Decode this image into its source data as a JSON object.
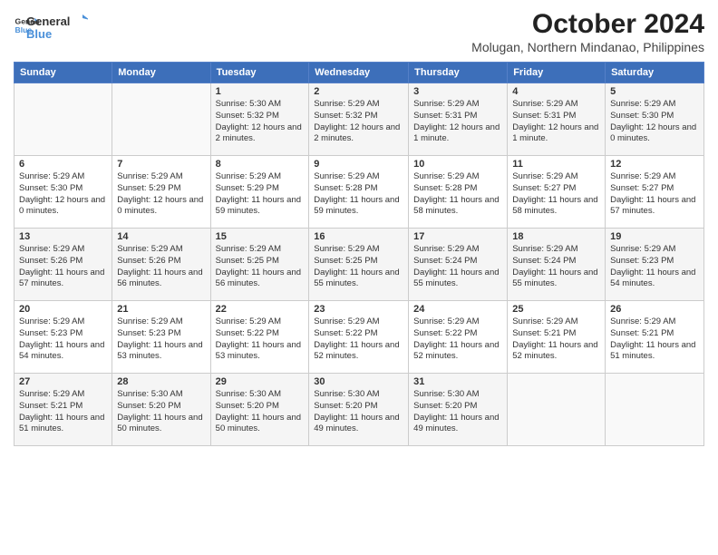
{
  "header": {
    "logo_line1": "General",
    "logo_line2": "Blue",
    "title": "October 2024",
    "subtitle": "Molugan, Northern Mindanao, Philippines"
  },
  "days_of_week": [
    "Sunday",
    "Monday",
    "Tuesday",
    "Wednesday",
    "Thursday",
    "Friday",
    "Saturday"
  ],
  "weeks": [
    [
      {
        "day": "",
        "content": ""
      },
      {
        "day": "",
        "content": ""
      },
      {
        "day": "1",
        "content": "Sunrise: 5:30 AM\nSunset: 5:32 PM\nDaylight: 12 hours and 2 minutes."
      },
      {
        "day": "2",
        "content": "Sunrise: 5:29 AM\nSunset: 5:32 PM\nDaylight: 12 hours and 2 minutes."
      },
      {
        "day": "3",
        "content": "Sunrise: 5:29 AM\nSunset: 5:31 PM\nDaylight: 12 hours and 1 minute."
      },
      {
        "day": "4",
        "content": "Sunrise: 5:29 AM\nSunset: 5:31 PM\nDaylight: 12 hours and 1 minute."
      },
      {
        "day": "5",
        "content": "Sunrise: 5:29 AM\nSunset: 5:30 PM\nDaylight: 12 hours and 0 minutes."
      }
    ],
    [
      {
        "day": "6",
        "content": "Sunrise: 5:29 AM\nSunset: 5:30 PM\nDaylight: 12 hours and 0 minutes."
      },
      {
        "day": "7",
        "content": "Sunrise: 5:29 AM\nSunset: 5:29 PM\nDaylight: 12 hours and 0 minutes."
      },
      {
        "day": "8",
        "content": "Sunrise: 5:29 AM\nSunset: 5:29 PM\nDaylight: 11 hours and 59 minutes."
      },
      {
        "day": "9",
        "content": "Sunrise: 5:29 AM\nSunset: 5:28 PM\nDaylight: 11 hours and 59 minutes."
      },
      {
        "day": "10",
        "content": "Sunrise: 5:29 AM\nSunset: 5:28 PM\nDaylight: 11 hours and 58 minutes."
      },
      {
        "day": "11",
        "content": "Sunrise: 5:29 AM\nSunset: 5:27 PM\nDaylight: 11 hours and 58 minutes."
      },
      {
        "day": "12",
        "content": "Sunrise: 5:29 AM\nSunset: 5:27 PM\nDaylight: 11 hours and 57 minutes."
      }
    ],
    [
      {
        "day": "13",
        "content": "Sunrise: 5:29 AM\nSunset: 5:26 PM\nDaylight: 11 hours and 57 minutes."
      },
      {
        "day": "14",
        "content": "Sunrise: 5:29 AM\nSunset: 5:26 PM\nDaylight: 11 hours and 56 minutes."
      },
      {
        "day": "15",
        "content": "Sunrise: 5:29 AM\nSunset: 5:25 PM\nDaylight: 11 hours and 56 minutes."
      },
      {
        "day": "16",
        "content": "Sunrise: 5:29 AM\nSunset: 5:25 PM\nDaylight: 11 hours and 55 minutes."
      },
      {
        "day": "17",
        "content": "Sunrise: 5:29 AM\nSunset: 5:24 PM\nDaylight: 11 hours and 55 minutes."
      },
      {
        "day": "18",
        "content": "Sunrise: 5:29 AM\nSunset: 5:24 PM\nDaylight: 11 hours and 55 minutes."
      },
      {
        "day": "19",
        "content": "Sunrise: 5:29 AM\nSunset: 5:23 PM\nDaylight: 11 hours and 54 minutes."
      }
    ],
    [
      {
        "day": "20",
        "content": "Sunrise: 5:29 AM\nSunset: 5:23 PM\nDaylight: 11 hours and 54 minutes."
      },
      {
        "day": "21",
        "content": "Sunrise: 5:29 AM\nSunset: 5:23 PM\nDaylight: 11 hours and 53 minutes."
      },
      {
        "day": "22",
        "content": "Sunrise: 5:29 AM\nSunset: 5:22 PM\nDaylight: 11 hours and 53 minutes."
      },
      {
        "day": "23",
        "content": "Sunrise: 5:29 AM\nSunset: 5:22 PM\nDaylight: 11 hours and 52 minutes."
      },
      {
        "day": "24",
        "content": "Sunrise: 5:29 AM\nSunset: 5:22 PM\nDaylight: 11 hours and 52 minutes."
      },
      {
        "day": "25",
        "content": "Sunrise: 5:29 AM\nSunset: 5:21 PM\nDaylight: 11 hours and 52 minutes."
      },
      {
        "day": "26",
        "content": "Sunrise: 5:29 AM\nSunset: 5:21 PM\nDaylight: 11 hours and 51 minutes."
      }
    ],
    [
      {
        "day": "27",
        "content": "Sunrise: 5:29 AM\nSunset: 5:21 PM\nDaylight: 11 hours and 51 minutes."
      },
      {
        "day": "28",
        "content": "Sunrise: 5:30 AM\nSunset: 5:20 PM\nDaylight: 11 hours and 50 minutes."
      },
      {
        "day": "29",
        "content": "Sunrise: 5:30 AM\nSunset: 5:20 PM\nDaylight: 11 hours and 50 minutes."
      },
      {
        "day": "30",
        "content": "Sunrise: 5:30 AM\nSunset: 5:20 PM\nDaylight: 11 hours and 49 minutes."
      },
      {
        "day": "31",
        "content": "Sunrise: 5:30 AM\nSunset: 5:20 PM\nDaylight: 11 hours and 49 minutes."
      },
      {
        "day": "",
        "content": ""
      },
      {
        "day": "",
        "content": ""
      }
    ]
  ]
}
